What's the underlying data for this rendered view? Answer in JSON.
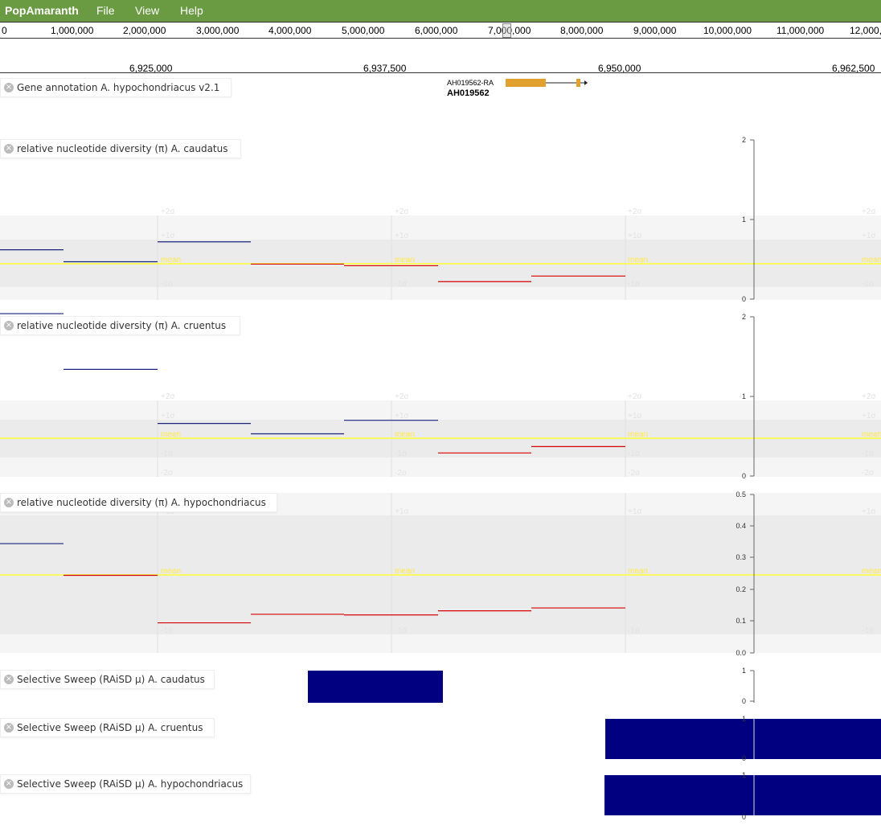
{
  "app": {
    "title": "PopAmaranth",
    "menu": [
      "File",
      "View",
      "Help"
    ]
  },
  "overview": {
    "ticks": [
      "0",
      "1,000,000",
      "2,000,000",
      "3,000,000",
      "4,000,000",
      "5,000,000",
      "6,000,000",
      "7,000,000",
      "8,000,000",
      "9,000,000",
      "10,000,000",
      "11,000,000",
      "12,000,"
    ]
  },
  "detail_axis": {
    "ticks": [
      "6,925,000",
      "6,937,500",
      "6,950,000",
      "6,962,500"
    ]
  },
  "colors": {
    "menubar": "#6a9a42",
    "above_mean": "#1a237e",
    "below_mean": "#d50000",
    "mean": "#ffff33",
    "sweep": "#000080",
    "gene": "#e0a22c"
  },
  "tracks": [
    {
      "id": "gene",
      "label": "Gene annotation A. hypochondriacus v2.1",
      "gene": {
        "transcript": "AH019562-RA",
        "name": "AH019562",
        "strand": "+"
      }
    },
    {
      "id": "pi_caud",
      "label": "relative nucleotide diversity (π) A. caudatus",
      "y_ticks": [
        "2",
        "1",
        "0"
      ],
      "band_labels": [
        "+2σ",
        "+1σ",
        "mean",
        "-1σ"
      ],
      "segments": [
        {
          "v": 0.62,
          "c": "above"
        },
        {
          "v": 0.47,
          "c": "above"
        },
        {
          "v": 0.72,
          "c": "above"
        },
        {
          "v": 0.44,
          "c": "below"
        },
        {
          "v": 0.42,
          "c": "below"
        },
        {
          "v": 0.22,
          "c": "below"
        },
        {
          "v": 0.29,
          "c": "below"
        }
      ]
    },
    {
      "id": "pi_cru",
      "label": "relative nucleotide diversity (π) A. cruentus",
      "y_ticks": [
        "2",
        "1",
        "0"
      ],
      "band_labels": [
        "+2σ",
        "+1σ",
        "mean",
        "-1σ",
        "-2σ"
      ],
      "segments": [
        {
          "v": 2.04,
          "c": "above"
        },
        {
          "v": 1.34,
          "c": "above"
        },
        {
          "v": 0.66,
          "c": "above"
        },
        {
          "v": 0.53,
          "c": "above"
        },
        {
          "v": 0.7,
          "c": "above"
        },
        {
          "v": 0.29,
          "c": "below"
        },
        {
          "v": 0.37,
          "c": "below"
        }
      ]
    },
    {
      "id": "pi_hyp",
      "label": "relative nucleotide diversity (π) A. hypochondriacus",
      "y_ticks": [
        "0.5",
        "0.4",
        "0.3",
        "0.2",
        "0.1",
        "0.0"
      ],
      "band_labels": [
        "+1σ",
        "mean",
        "-1σ"
      ],
      "segments": [
        {
          "v": 0.345,
          "c": "above"
        },
        {
          "v": 0.245,
          "c": "below"
        },
        {
          "v": 0.095,
          "c": "below"
        },
        {
          "v": 0.122,
          "c": "below"
        },
        {
          "v": 0.12,
          "c": "below"
        },
        {
          "v": 0.133,
          "c": "below"
        },
        {
          "v": 0.142,
          "c": "below"
        }
      ]
    },
    {
      "id": "sw_caud",
      "label": "Selective Sweep (RAiSD μ) A. caudatus",
      "y_ticks": [
        "1",
        "0"
      ]
    },
    {
      "id": "sw_cru",
      "label": "Selective Sweep (RAiSD μ) A. cruentus",
      "y_ticks": [
        "1",
        "0"
      ]
    },
    {
      "id": "sw_hyp",
      "label": "Selective Sweep (RAiSD μ) A. hypochondriacus",
      "y_ticks": [
        "1",
        "0"
      ]
    }
  ]
}
